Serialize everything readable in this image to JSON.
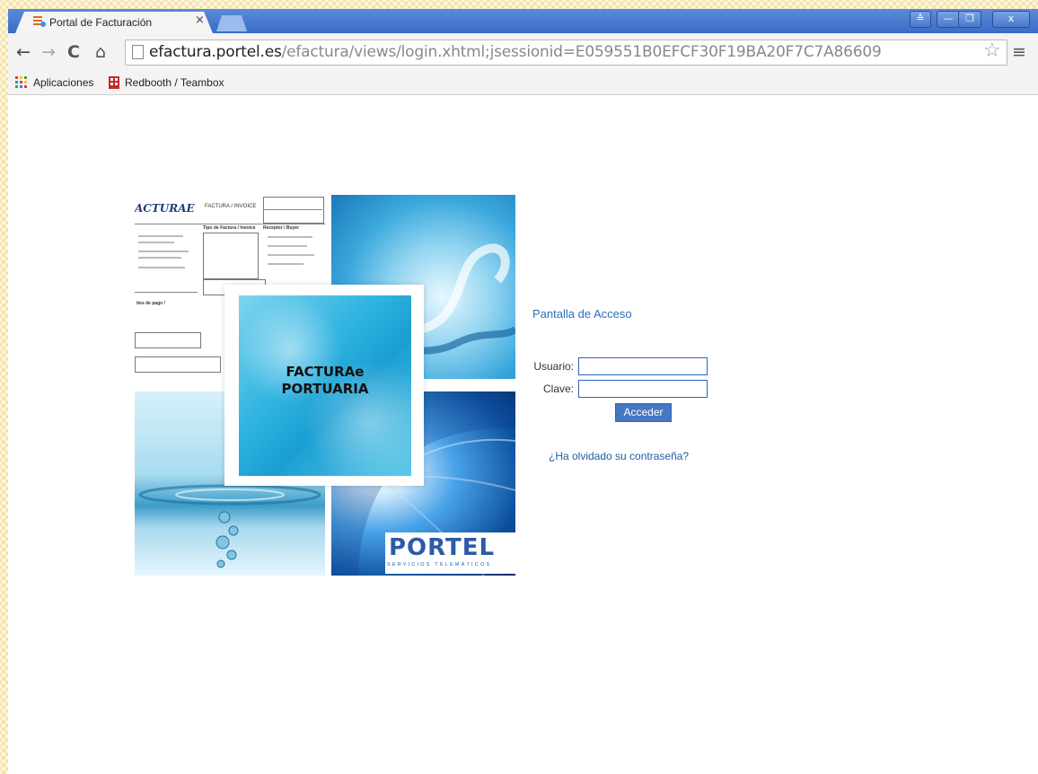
{
  "browser": {
    "tab_title": "Portal de Facturación",
    "tab_close": "×",
    "url_host": "efactura.portel.es",
    "url_path": "/efactura/views/login.xhtml;jsessionid=E059551B0EFCF30F19BA20F7C7A86609",
    "window_buttons": {
      "user": "≙",
      "minimize": "—",
      "maximize": "❐",
      "close": "x"
    },
    "nav": {
      "back": "←",
      "forward": "→",
      "reload": "C",
      "home": "⌂",
      "star": "☆",
      "menu": "≡"
    },
    "bookmarks": [
      {
        "label": "Aplicaciones",
        "icon": "apps-grid-icon"
      },
      {
        "label": "Redbooth / Teambox",
        "icon": "redbooth-icon"
      }
    ]
  },
  "collage": {
    "center_title": "FACTURAe\nPORTUARIA",
    "invoice_brand": "ACTURAE",
    "invoice_header": "FACTURA / INVOICE",
    "invoice_section_tipo": "Tipo de Factura / Invoice",
    "invoice_section_receptor": "Receptor / Buyer",
    "invoice_section_pago": "ites de pago /",
    "portel_name": "PORTEL",
    "portel_tagline": "SERVICIOS TELEMÁTICOS"
  },
  "login": {
    "title": "Pantalla de Acceso",
    "user_label": "Usuario:",
    "password_label": "Clave:",
    "user_value": "",
    "password_value": "",
    "submit_label": "Acceder",
    "forgot_link": "¿Ha olvidado su contraseña?"
  },
  "colors": {
    "accent": "#4477c4",
    "link": "#1d5fa6",
    "title": "#2a6ebb",
    "titlebar": "#3a6cc6"
  }
}
